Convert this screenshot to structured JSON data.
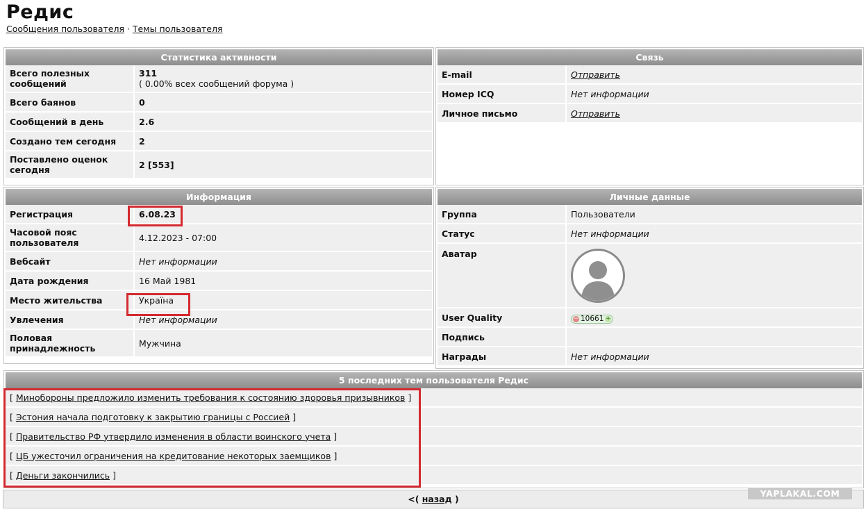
{
  "page": {
    "title": "Редис",
    "links": [
      "Сообщения пользователя",
      "Темы пользователя"
    ],
    "links_sep": " · "
  },
  "stats": {
    "header": "Статистика активности",
    "rows": [
      {
        "label": "Всего полезных сообщений",
        "value": "311",
        "sub": "( 0.00% всех сообщений форума )"
      },
      {
        "label": "Всего баянов",
        "value": "0"
      },
      {
        "label": "Сообщений в день",
        "value": "2.6"
      },
      {
        "label": "Создано тем сегодня",
        "value": "2"
      },
      {
        "label": "Поставлено оценок сегодня",
        "value": "2 [553]"
      }
    ]
  },
  "contact": {
    "header": "Связь",
    "rows": [
      {
        "label": "E-mail",
        "value": "Отправить"
      },
      {
        "label": "Номер ICQ",
        "value": "Нет информации"
      },
      {
        "label": "Личное письмо",
        "value": "Отправить"
      }
    ]
  },
  "info": {
    "header": "Информация",
    "rows": [
      {
        "label": "Регистрация",
        "value": "6.08.23"
      },
      {
        "label": "Часовой пояс пользователя",
        "value": "4.12.2023 - 07:00"
      },
      {
        "label": "Вебсайт",
        "value": "Нет информации"
      },
      {
        "label": "Дата рождения",
        "value": "16 Май 1981"
      },
      {
        "label": "Место жительства",
        "value": "Україна"
      },
      {
        "label": "Увлечения",
        "value": "Нет информации"
      },
      {
        "label": "Половая принадлежность",
        "value": "Мужчина"
      }
    ]
  },
  "personal": {
    "header": "Личные данные",
    "rows": [
      {
        "label": "Группа",
        "value": "Пользователи"
      },
      {
        "label": "Статус",
        "value": "Нет информации"
      },
      {
        "label": "Аватар",
        "value": ""
      },
      {
        "label": "User Quality",
        "value": "10661"
      },
      {
        "label": "Подпись",
        "value": ""
      },
      {
        "label": "Награды",
        "value": "Нет информации"
      }
    ],
    "avatar_icon": "user-silhouette-icon",
    "quality_minus": "−",
    "quality_plus": "+"
  },
  "topics": {
    "header": "5 последних тем пользователя Редис",
    "items": [
      "Минобороны предложило изменить требования к состоянию здоровья призывников",
      "Эстония начала подготовку к закрытию границы с Россией",
      "Правительство РФ утвердило изменения в области воинского учета",
      "ЦБ ужесточил ограничения на кредитование некоторых заемщиков",
      "Деньги закончились"
    ],
    "open_bracket": "[",
    "close_bracket": "]"
  },
  "back": {
    "prefix": "<(",
    "link": "назад",
    "suffix": ")"
  },
  "watermark": "YAPLAKAL.COM",
  "colors": {
    "highlight": "#d42a2f",
    "header_gradient_top": "#b4b4b4",
    "header_gradient_bottom": "#8e8e8e",
    "row_bg": "#efefef"
  }
}
